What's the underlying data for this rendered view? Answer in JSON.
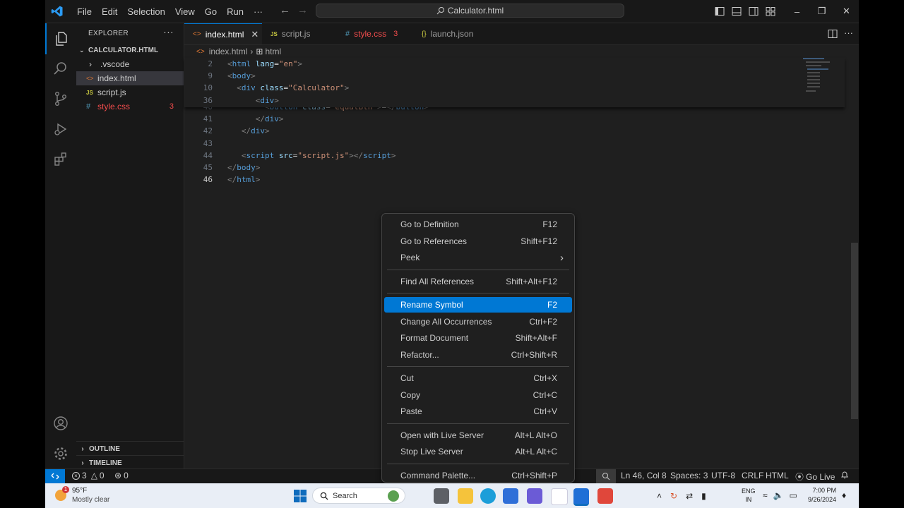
{
  "titlebar": {
    "menu": [
      "File",
      "Edit",
      "Selection",
      "View",
      "Go",
      "Run",
      "···"
    ],
    "command_center": "Calculator.html"
  },
  "sidebar": {
    "title": "EXPLORER",
    "folder": "CALCULATOR.HTML",
    "items": [
      {
        "label": ".vscode",
        "icon": "chevron-right-icon"
      },
      {
        "label": "index.html",
        "icon": "html-icon",
        "selected": true
      },
      {
        "label": "script.js",
        "icon": "js-icon"
      },
      {
        "label": "style.css",
        "icon": "css-icon",
        "badge": "3"
      }
    ],
    "outline": "OUTLINE",
    "timeline": "TIMELINE"
  },
  "tabs": [
    {
      "label": "index.html",
      "active": true
    },
    {
      "label": "script.js"
    },
    {
      "label": "style.css",
      "badge": "3"
    },
    {
      "label": "launch.json"
    }
  ],
  "breadcrumbs": [
    "index.html",
    "html"
  ],
  "code": {
    "sticky": [
      {
        "ln": "2",
        "tokens": [
          [
            "t-tag",
            "<"
          ],
          [
            "t-name",
            "html"
          ],
          [
            "t-txt",
            " "
          ],
          [
            "t-attr",
            "lang"
          ],
          [
            "t-txt",
            "="
          ],
          [
            "t-str",
            "\"en\""
          ],
          [
            "t-tag",
            ">"
          ]
        ]
      },
      {
        "ln": "9",
        "tokens": [
          [
            "t-tag",
            "<"
          ],
          [
            "t-name",
            "body"
          ],
          [
            "t-tag",
            ">"
          ]
        ]
      },
      {
        "ln": "10",
        "tokens": [
          [
            "t-txt",
            "  "
          ],
          [
            "t-tag",
            "<"
          ],
          [
            "t-name",
            "div"
          ],
          [
            "t-txt",
            " "
          ],
          [
            "t-attr",
            "class"
          ],
          [
            "t-txt",
            "="
          ],
          [
            "t-str",
            "\"Calculator\""
          ],
          [
            "t-tag",
            ">"
          ]
        ]
      },
      {
        "ln": "36",
        "tokens": [
          [
            "t-txt",
            "      "
          ],
          [
            "t-tag",
            "<"
          ],
          [
            "t-name",
            "div"
          ],
          [
            "t-tag",
            ">"
          ]
        ]
      }
    ],
    "lines": [
      {
        "ln": "40",
        "tokens": [
          [
            "t-txt",
            "        "
          ],
          [
            "t-tag",
            "<"
          ],
          [
            "t-name",
            "button"
          ],
          [
            "t-txt",
            " "
          ],
          [
            "t-attr",
            "class"
          ],
          [
            "t-txt",
            "="
          ],
          [
            "t-str",
            "\"equalBtn\""
          ],
          [
            "t-tag",
            ">"
          ],
          [
            "t-txt",
            "="
          ],
          [
            "t-tag",
            "</"
          ],
          [
            "t-name",
            "button"
          ],
          [
            "t-tag",
            ">"
          ]
        ]
      },
      {
        "ln": "41",
        "tokens": [
          [
            "t-txt",
            "      "
          ],
          [
            "t-tag",
            "</"
          ],
          [
            "t-name",
            "div"
          ],
          [
            "t-tag",
            ">"
          ]
        ]
      },
      {
        "ln": "42",
        "tokens": [
          [
            "t-txt",
            "   "
          ],
          [
            "t-tag",
            "</"
          ],
          [
            "t-name",
            "div"
          ],
          [
            "t-tag",
            ">"
          ]
        ]
      },
      {
        "ln": "43",
        "tokens": []
      },
      {
        "ln": "44",
        "tokens": [
          [
            "t-txt",
            "   "
          ],
          [
            "t-tag",
            "<"
          ],
          [
            "t-name",
            "script"
          ],
          [
            "t-txt",
            " "
          ],
          [
            "t-attr",
            "src"
          ],
          [
            "t-txt",
            "="
          ],
          [
            "t-str",
            "\"script.js\""
          ],
          [
            "t-tag",
            "></"
          ],
          [
            "t-name",
            "script"
          ],
          [
            "t-tag",
            ">"
          ]
        ]
      },
      {
        "ln": "45",
        "tokens": [
          [
            "t-tag",
            "</"
          ],
          [
            "t-name",
            "body"
          ],
          [
            "t-tag",
            ">"
          ]
        ]
      },
      {
        "ln": "46",
        "tokens": [
          [
            "t-tag",
            "</"
          ],
          [
            "t-name",
            "html"
          ],
          [
            "t-tag",
            ">"
          ]
        ],
        "current": true
      }
    ]
  },
  "context_menu": {
    "groups": [
      [
        {
          "label": "Go to Definition",
          "key": "F12"
        },
        {
          "label": "Go to References",
          "key": "Shift+F12"
        },
        {
          "label": "Peek",
          "key": "›"
        }
      ],
      [
        {
          "label": "Find All References",
          "key": "Shift+Alt+F12"
        }
      ],
      [
        {
          "label": "Rename Symbol",
          "key": "F2",
          "highlighted": true
        },
        {
          "label": "Change All Occurrences",
          "key": "Ctrl+F2"
        },
        {
          "label": "Format Document",
          "key": "Shift+Alt+F"
        },
        {
          "label": "Refactor...",
          "key": "Ctrl+Shift+R"
        }
      ],
      [
        {
          "label": "Cut",
          "key": "Ctrl+X"
        },
        {
          "label": "Copy",
          "key": "Ctrl+C"
        },
        {
          "label": "Paste",
          "key": "Ctrl+V"
        }
      ],
      [
        {
          "label": "Open with Live Server",
          "key": "Alt+L Alt+O"
        },
        {
          "label": "Stop Live Server",
          "key": "Alt+L Alt+C"
        }
      ],
      [
        {
          "label": "Command Palette...",
          "key": "Ctrl+Shift+P"
        }
      ]
    ]
  },
  "status": {
    "errors": "3",
    "warnings": "0",
    "ports": "0",
    "position": "Ln 46, Col 8",
    "spaces": "Spaces: 3",
    "encoding": "UTF-8",
    "eol": "CRLF",
    "language": "HTML",
    "golive": "Go Live"
  },
  "taskbar": {
    "temp": "95°F",
    "weather": "Mostly clear",
    "weather_badge": "1",
    "search": "Search",
    "lang_top": "ENG",
    "lang_bottom": "IN",
    "time": "7:00 PM",
    "date": "9/26/2024"
  },
  "colors": {
    "accent": "#0078d4",
    "error": "#f14c4c",
    "html": "#e37933",
    "js": "#cbcb41",
    "css": "#519aba"
  }
}
